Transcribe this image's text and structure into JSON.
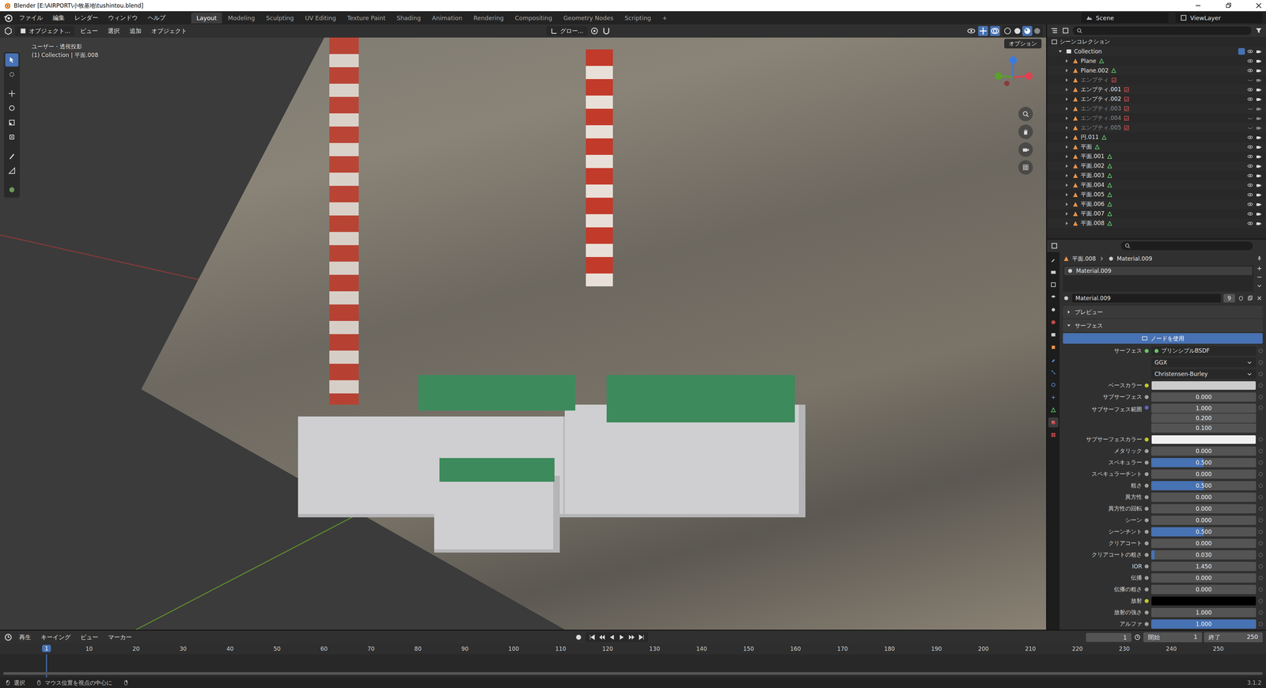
{
  "window": {
    "title": "Blender [E:\\AIRPORT\\小牧基地\\tushintou.blend]"
  },
  "menu": [
    "ファイル",
    "編集",
    "レンダー",
    "ウィンドウ",
    "ヘルプ"
  ],
  "workspaces": [
    {
      "label": "Layout",
      "selected": true
    },
    {
      "label": "Modeling",
      "selected": false
    },
    {
      "label": "Sculpting",
      "selected": false
    },
    {
      "label": "UV Editing",
      "selected": false
    },
    {
      "label": "Texture Paint",
      "selected": false
    },
    {
      "label": "Shading",
      "selected": false
    },
    {
      "label": "Animation",
      "selected": false
    },
    {
      "label": "Rendering",
      "selected": false
    },
    {
      "label": "Compositing",
      "selected": false
    },
    {
      "label": "Geometry Nodes",
      "selected": false
    },
    {
      "label": "Scripting",
      "selected": false
    }
  ],
  "add_workspace": "+",
  "scene": "Scene",
  "view_layer": "ViewLayer",
  "viewport": {
    "mode": "オブジェクト...",
    "menus": [
      "ビュー",
      "選択",
      "追加",
      "オブジェクト"
    ],
    "transform": "グロー...",
    "options": "オプション",
    "overlay_title": "ユーザー・透視投影",
    "overlay_object": "(1) Collection | 平面.008"
  },
  "outliner": {
    "root": "シーンコレクション",
    "collection": {
      "name": "Collection",
      "checked": true
    },
    "items": [
      {
        "name": "Plane",
        "kind": "mesh",
        "visible": true
      },
      {
        "name": "Plane.002",
        "kind": "mesh",
        "visible": true
      },
      {
        "name": "エンプティ",
        "kind": "empty",
        "visible": false
      },
      {
        "name": "エンプティ.001",
        "kind": "empty",
        "visible": true
      },
      {
        "name": "エンプティ.002",
        "kind": "empty",
        "visible": true
      },
      {
        "name": "エンプティ.003",
        "kind": "empty",
        "visible": false
      },
      {
        "name": "エンプティ.004",
        "kind": "empty",
        "visible": false
      },
      {
        "name": "エンプティ.005",
        "kind": "empty",
        "visible": false
      },
      {
        "name": "円.011",
        "kind": "mesh",
        "visible": true
      },
      {
        "name": "平面",
        "kind": "mesh",
        "visible": true
      },
      {
        "name": "平面.001",
        "kind": "mesh",
        "visible": true
      },
      {
        "name": "平面.002",
        "kind": "mesh",
        "visible": true
      },
      {
        "name": "平面.003",
        "kind": "mesh",
        "visible": true
      },
      {
        "name": "平面.004",
        "kind": "mesh",
        "visible": true
      },
      {
        "name": "平面.005",
        "kind": "mesh",
        "visible": true
      },
      {
        "name": "平面.006",
        "kind": "mesh",
        "visible": true
      },
      {
        "name": "平面.007",
        "kind": "mesh",
        "visible": true
      },
      {
        "name": "平面.008",
        "kind": "mesh",
        "visible": true
      }
    ]
  },
  "properties": {
    "object": "平面.008",
    "material": "Material.009",
    "slots": [
      {
        "name": "Material.009",
        "selected": true
      }
    ],
    "datablock": "Material.009",
    "users": "9",
    "panels": [
      {
        "label": "プレビュー",
        "expanded": false
      },
      {
        "label": "サーフェス",
        "expanded": true
      }
    ],
    "use_nodes": "ノードを使用",
    "rows": [
      {
        "kind": "shader",
        "label": "サーフェス",
        "value": "プリンシプルBSDF",
        "color": "#63c763"
      },
      {
        "kind": "dropdown",
        "value": "GGX"
      },
      {
        "kind": "dropdown",
        "value": "Christensen-Burley"
      },
      {
        "kind": "color",
        "label": "ベースカラー",
        "swatch": "#cccccc",
        "color": "#c7c729"
      },
      {
        "kind": "slider",
        "label": "サブサーフェス",
        "value": "0.000",
        "level": 0,
        "color": "#a1a1a1"
      },
      {
        "kind": "vector",
        "label": "サブサーフェス範囲",
        "values": [
          "1.000",
          "0.200",
          "0.100"
        ],
        "color": "#6363c7"
      },
      {
        "kind": "color",
        "label": "サブサーフェスカラー",
        "swatch": "#f0f0f0",
        "color": "#c7c729"
      },
      {
        "kind": "slider",
        "label": "メタリック",
        "value": "0.000",
        "level": 0,
        "color": "#a1a1a1"
      },
      {
        "kind": "slider",
        "label": "スペキュラー",
        "value": "0.500",
        "level": 0.5,
        "color": "#a1a1a1"
      },
      {
        "kind": "slider",
        "label": "スペキュラーチント",
        "value": "0.000",
        "level": 0,
        "color": "#a1a1a1"
      },
      {
        "kind": "slider",
        "label": "粗さ",
        "value": "0.500",
        "level": 0.5,
        "color": "#a1a1a1"
      },
      {
        "kind": "slider",
        "label": "異方性",
        "value": "0.000",
        "level": 0,
        "color": "#a1a1a1"
      },
      {
        "kind": "slider",
        "label": "異方性の回転",
        "value": "0.000",
        "level": 0,
        "color": "#a1a1a1"
      },
      {
        "kind": "slider",
        "label": "シーン",
        "value": "0.000",
        "level": 0,
        "color": "#a1a1a1"
      },
      {
        "kind": "slider",
        "label": "シーンチント",
        "value": "0.500",
        "level": 0.5,
        "color": "#a1a1a1"
      },
      {
        "kind": "slider",
        "label": "クリアコート",
        "value": "0.000",
        "level": 0,
        "color": "#a1a1a1"
      },
      {
        "kind": "slider",
        "label": "クリアコートの粗さ",
        "value": "0.030",
        "level": 0.03,
        "color": "#a1a1a1"
      },
      {
        "kind": "number",
        "label": "IOR",
        "value": "1.450",
        "color": "#a1a1a1"
      },
      {
        "kind": "slider",
        "label": "伝播",
        "value": "0.000",
        "level": 0,
        "color": "#a1a1a1"
      },
      {
        "kind": "slider",
        "label": "伝播の粗さ",
        "value": "0.000",
        "level": 0,
        "color": "#a1a1a1"
      },
      {
        "kind": "color",
        "label": "放射",
        "swatch": "#000000",
        "color": "#c7c729"
      },
      {
        "kind": "number",
        "label": "放射の強さ",
        "value": "1.000",
        "color": "#a1a1a1"
      },
      {
        "kind": "slider",
        "label": "アルファ",
        "value": "1.000",
        "level": 1,
        "color": "#a1a1a1"
      }
    ]
  },
  "timeline": {
    "menus": [
      "再生",
      "キーイング",
      "ビュー",
      "マーカー"
    ],
    "current_frame": "1",
    "start_label": "開始",
    "start": "1",
    "end_label": "終了",
    "end": "250",
    "playhead": "1",
    "ticks": [
      "10",
      "20",
      "30",
      "40",
      "50",
      "60",
      "70",
      "80",
      "90",
      "100",
      "110",
      "120",
      "130",
      "140",
      "150",
      "160",
      "170",
      "180",
      "190",
      "200",
      "210",
      "220",
      "230",
      "240",
      "250"
    ]
  },
  "status_bar": {
    "left": "選択",
    "middle": "マウス位置を視点の中心に",
    "version": "3.1.2"
  }
}
